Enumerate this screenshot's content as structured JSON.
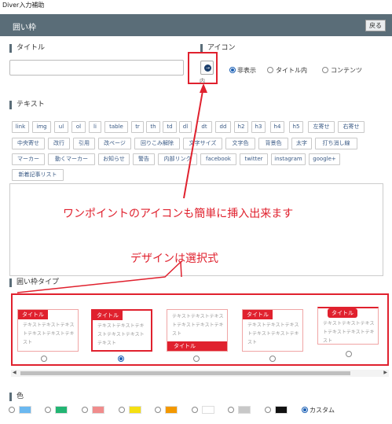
{
  "window": {
    "title": "Diver入力補助"
  },
  "header": {
    "title": "囲い枠",
    "back_label": "戻る"
  },
  "fields": {
    "title_label": "タイトル",
    "icon_label": "アイコン",
    "icon_button_glyph": "→",
    "icon_note": "内",
    "icon_options": [
      "非表示",
      "タイトル内",
      "コンテンツ"
    ],
    "text_label": "テキスト"
  },
  "tag_buttons": [
    [
      "link",
      "img",
      "ul",
      "ol",
      "li",
      "table",
      "tr",
      "th",
      "td",
      "dl",
      "dt",
      "dd",
      "h2",
      "h3",
      "h4",
      "h5",
      "左寄せ",
      "右寄せ"
    ],
    [
      "中央寄せ",
      "改行",
      "引用",
      "改ページ",
      "回りこみ解除",
      "文字サイズ",
      "文字色",
      "背景色",
      "太字",
      "打ち消し線"
    ],
    [
      "マーカー",
      "動くマーカー",
      "お知らせ",
      "警告",
      "内部リンク",
      "facebook",
      "twitter",
      "instagram",
      "google+"
    ],
    [
      "新着記事リスト"
    ]
  ],
  "annotations": {
    "icon_note": "ワンポイントのアイコンも簡単に挿入出来ます",
    "design_note": "デザインは選択式"
  },
  "frame_type": {
    "label": "囲い枠タイプ",
    "cards": [
      {
        "title": "タイトル",
        "body": "テキストテキストテキストテキストテキストテキスト"
      },
      {
        "title": "タイトル",
        "body": "テキストテキストテキストテキストテキストテキスト"
      },
      {
        "title": "タイトル",
        "body": "テキストテキストテキストテキストテキストテキスト"
      },
      {
        "title": "タイトル",
        "body": "テキストテキストテキストテキストテキストテキスト"
      },
      {
        "title": "タイトル",
        "body": "テキストテキストテキストテキストテキストテキスト"
      }
    ],
    "selected_index": 1
  },
  "color": {
    "label": "色",
    "swatches": [
      "#6bb8f0",
      "#22b573",
      "#f08c8c",
      "#f5e012",
      "#f39800",
      "#ffffff",
      "#c8c8c8",
      "#111111"
    ],
    "custom_label": "カスタム",
    "selected": "custom"
  },
  "colors": {
    "header": "#5a6d78",
    "accent": "#e0212e",
    "link": "#3a5a85"
  }
}
